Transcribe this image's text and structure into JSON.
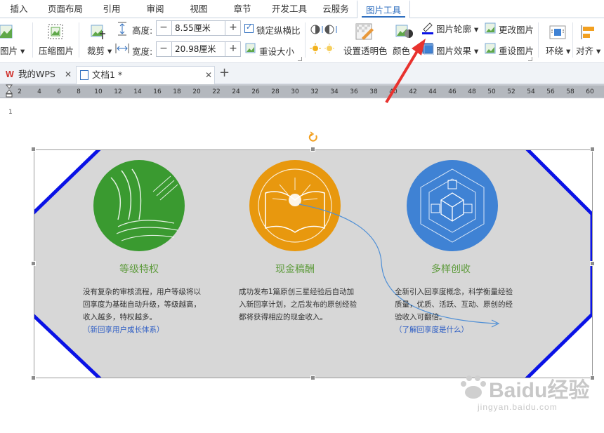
{
  "menu": {
    "tabs": [
      {
        "label": "插入"
      },
      {
        "label": "页面布局"
      },
      {
        "label": "引用"
      },
      {
        "label": "审阅"
      },
      {
        "label": "视图"
      },
      {
        "label": "章节"
      },
      {
        "label": "开发工具"
      },
      {
        "label": "云服务"
      },
      {
        "label": "图片工具"
      }
    ],
    "active_index": 8
  },
  "ribbon": {
    "insert_picture_label": "图片",
    "compress_label": "压缩图片",
    "crop_label": "裁剪",
    "height_label": "高度:",
    "height_value": "8.55厘米",
    "width_label": "宽度:",
    "width_value": "20.98厘米",
    "lock_ratio_label": "锁定纵横比",
    "reset_size_label": "重设大小",
    "set_transparent_label": "设置透明色",
    "color_label": "颜色",
    "outline_label": "图片轮廓",
    "effects_label": "图片效果",
    "change_picture_label": "更改图片",
    "reset_picture_label": "重设图片",
    "wrap_label": "环绕",
    "align_label": "对齐",
    "lock_ratio_checked": true
  },
  "doc_tabs": [
    {
      "label": "我的WPS"
    },
    {
      "label": "文档1 *"
    }
  ],
  "ruler": {
    "ticks": [
      "2",
      "4",
      "6",
      "8",
      "10",
      "12",
      "14",
      "16",
      "18",
      "20",
      "22",
      "24",
      "26",
      "28",
      "30",
      "32",
      "34",
      "36",
      "38",
      "40",
      "42",
      "44",
      "46",
      "48",
      "50",
      "52",
      "54",
      "56",
      "58",
      "60"
    ]
  },
  "page": {
    "page_number": "1"
  },
  "features": [
    {
      "title": "等级特权",
      "text": "没有复杂的审核流程，用户等级将以回享度为基础自动升级，等级越高，收入越多，特权越多。",
      "link": "（新回享用户成长体系）"
    },
    {
      "title": "现金稿酬",
      "text": "成功发布1篇原创三星经验后自动加入新回享计划，之后发布的原创经验都将获得相应的现金收入。",
      "link": ""
    },
    {
      "title": "多样创收",
      "text": "全新引入回享度概念，科学衡量经验质量，优质、活跃、互动、原创的经验收入可翻倍。",
      "link": "（了解回享度是什么）"
    }
  ],
  "colors": {
    "outline": "#0a12e6",
    "shape_fill": "#d7d7d7",
    "circle_green": "#3a9a30",
    "circle_orange": "#e8980e",
    "circle_blue": "#3f82d4",
    "arrow": "#e8322e",
    "accent": "#2f6fbf"
  },
  "watermark": {
    "brand": "Baidu经验",
    "url": "jingyan.baidu.com"
  }
}
